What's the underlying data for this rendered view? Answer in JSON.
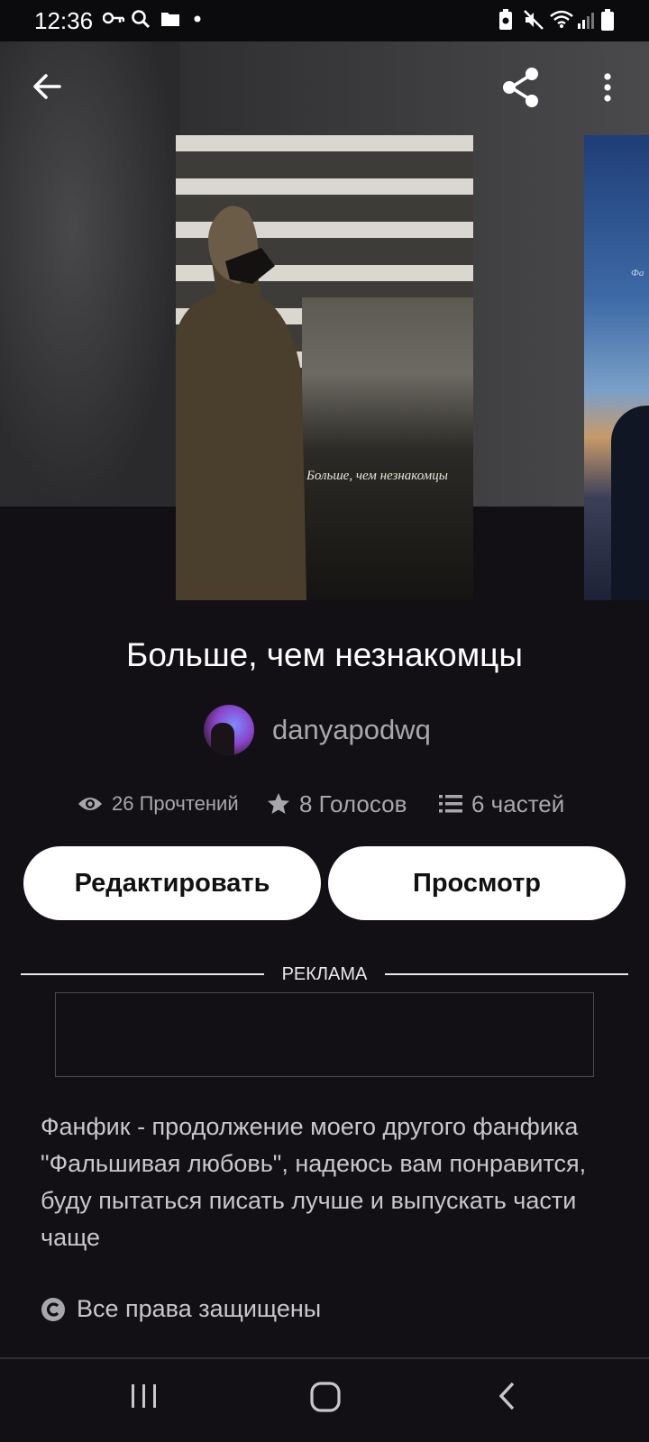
{
  "status_bar": {
    "time": "12:36",
    "left_icons": [
      "key-icon",
      "search-icon",
      "folder-icon",
      "dot-icon"
    ],
    "right_icons": [
      "battery-saver-icon",
      "mute-icon",
      "wifi-icon",
      "signal-icon",
      "battery-icon"
    ]
  },
  "app_bar": {
    "back_icon": "arrow-left-icon",
    "share_icon": "share-icon",
    "menu_icon": "more-vertical-icon"
  },
  "cover": {
    "caption": "Больше, чем незнакомцы"
  },
  "next_cover": {
    "caption": "Фа"
  },
  "story": {
    "title": "Больше, чем незнакомцы",
    "author": "danyapodwq",
    "reads": "26 Прочтений",
    "votes": "8 Голосов",
    "parts": "6 частей"
  },
  "actions": {
    "edit_label": "Редактировать",
    "view_label": "Просмотр"
  },
  "ad": {
    "label": "РЕКЛАМА"
  },
  "description": "Фанфик - продолжение моего другого фанфика \"Фальшивая любовь\", надеюсь вам понравится, буду пытаться писать лучше и выпускать части чаще",
  "copyright": "Все права защищены",
  "nav_bar": {
    "icons": [
      "recent-apps-icon",
      "home-icon",
      "back-icon"
    ]
  },
  "colors": {
    "background": "#121014",
    "button_bg": "#ffffff",
    "muted_text": "#a8a8ab"
  }
}
